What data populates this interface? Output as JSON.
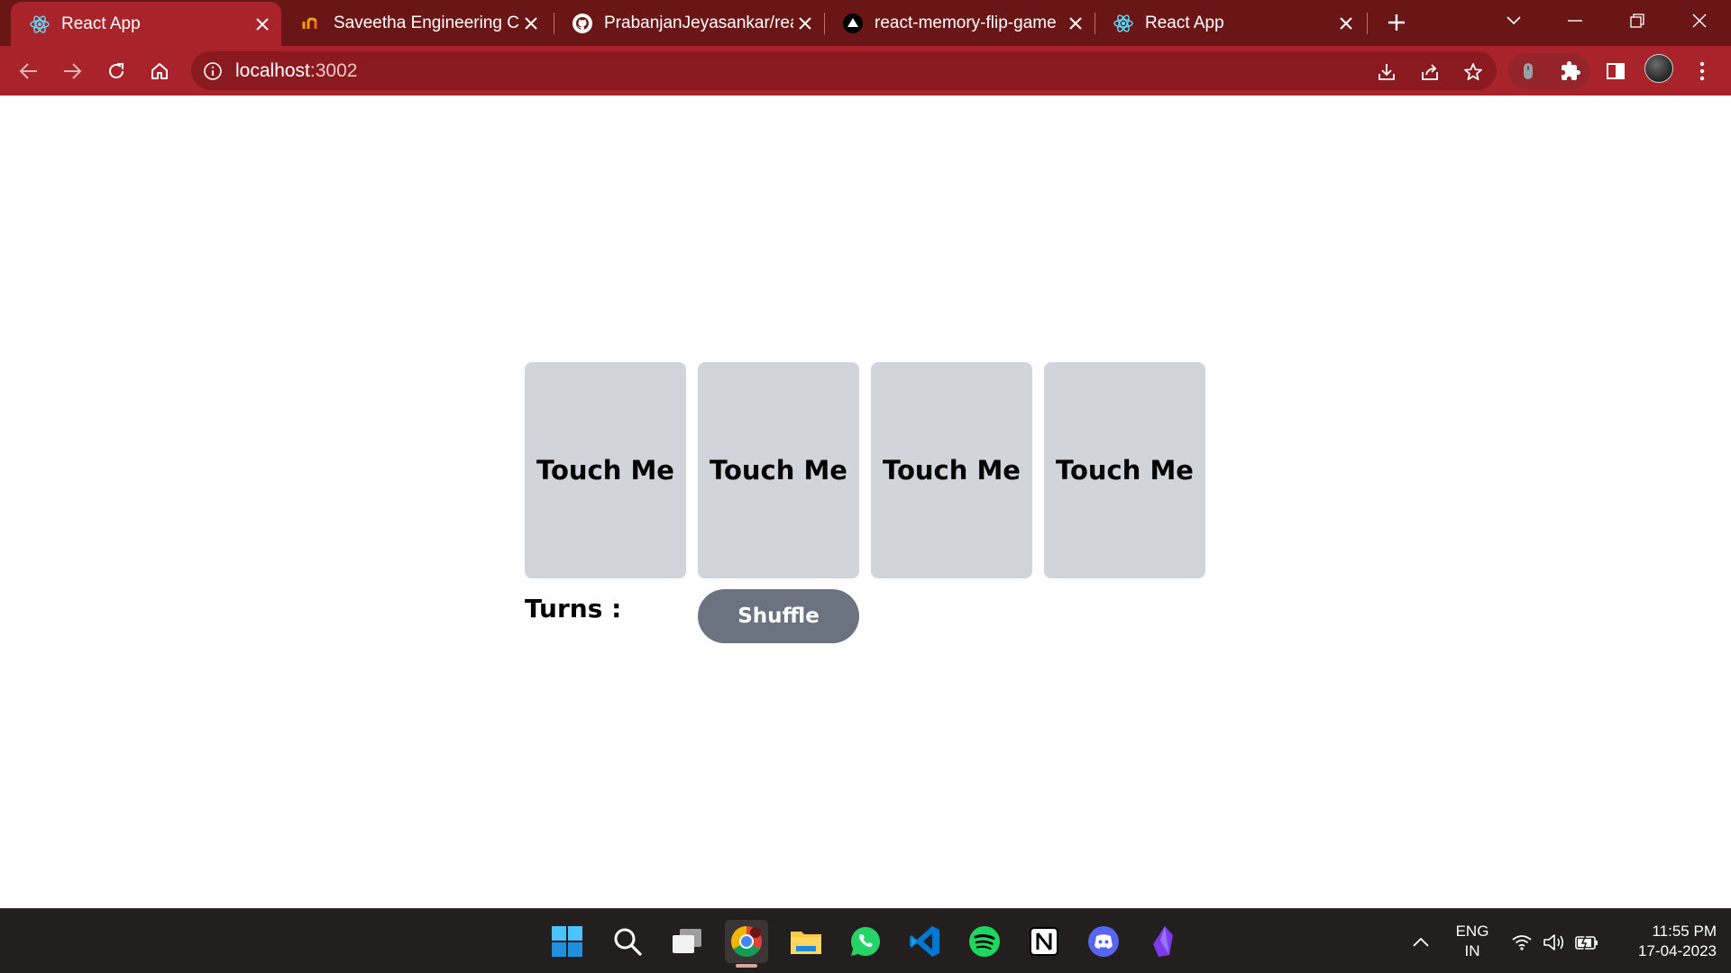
{
  "browser": {
    "tabs": [
      {
        "title": "React App",
        "favicon": "react-icon",
        "active": true
      },
      {
        "title": "Saveetha Engineering Coll",
        "favicon": "saveetha-icon",
        "active": false
      },
      {
        "title": "PrabanjanJeyasankar/reac",
        "favicon": "github-icon",
        "active": false
      },
      {
        "title": "react-memory-flip-game",
        "favicon": "vercel-icon",
        "active": false
      },
      {
        "title": "React App",
        "favicon": "react-icon",
        "active": false
      }
    ],
    "address": {
      "host": "localhost",
      "port": ":3002"
    },
    "colors": {
      "frame": "#6b1616",
      "toolbar": "#a8232a",
      "omnibox": "#8a1a20"
    }
  },
  "game": {
    "cards": [
      {
        "label": "Touch Me"
      },
      {
        "label": "Touch Me"
      },
      {
        "label": "Touch Me"
      },
      {
        "label": "Touch Me"
      }
    ],
    "turns_label": "Turns :",
    "turns_value": "",
    "shuffle_label": "Shuffle",
    "colors": {
      "card": "#d1d5db",
      "button": "#6b7280"
    }
  },
  "taskbar": {
    "apps": [
      "windows-start-icon",
      "search-icon",
      "task-view-icon",
      "chrome-icon",
      "file-explorer-icon",
      "whatsapp-icon",
      "vscode-icon",
      "spotify-icon",
      "notion-icon",
      "discord-icon",
      "obsidian-icon"
    ],
    "language": {
      "line1": "ENG",
      "line2": "IN"
    },
    "clock": {
      "time": "11:55 PM",
      "date": "17-04-2023"
    }
  }
}
